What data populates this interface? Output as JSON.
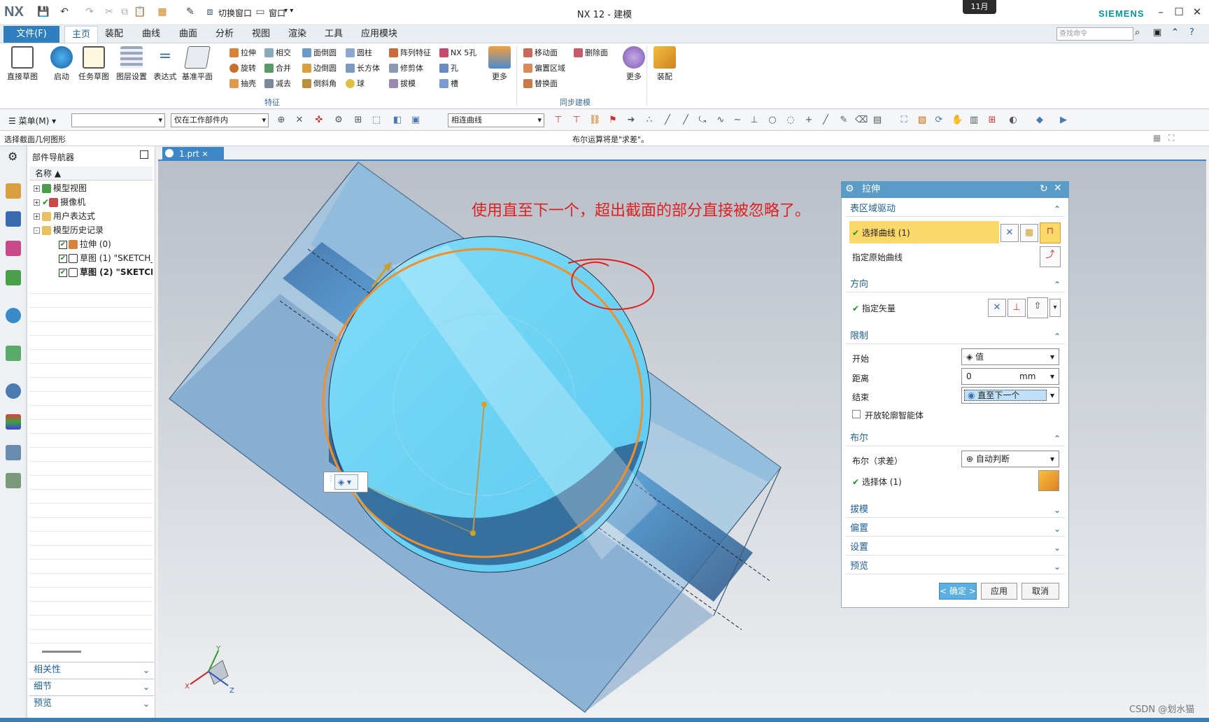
{
  "title_bar": {
    "logo": "NX",
    "switch_window": "切换窗口",
    "window_menu": "窗口",
    "title": "NX 12 - 建模",
    "date_badge": "11月",
    "brand": "SIEMENS",
    "brand_color": "#009999"
  },
  "menu": {
    "file": "文件(F)",
    "tabs": [
      "主页",
      "装配",
      "曲线",
      "曲面",
      "分析",
      "视图",
      "渲染",
      "工具",
      "应用模块"
    ],
    "active_tab": "主页",
    "search_placeholder": "查找命令"
  },
  "ribbon": {
    "big_buttons": [
      "直接草图",
      "启动",
      "任务草图",
      "图层设置",
      "表达式",
      "基准平面"
    ],
    "feature_col1": [
      "拉伸",
      "旋转",
      "抽壳"
    ],
    "feature_col2": [
      "相交",
      "合并",
      "减去"
    ],
    "feature_col3": [
      "面倒圆",
      "边倒圆",
      "倒斜角"
    ],
    "feature_col4": [
      "圆柱",
      "长方体",
      "球"
    ],
    "feature_col5": [
      "阵列特征",
      "修剪体",
      "拔模"
    ],
    "feature_col6": [
      "NX 5孔",
      "孔",
      "槽"
    ],
    "more1": "更多",
    "group_feature": "特征",
    "sync_col1": [
      "移动面",
      "偏置区域",
      "替换面"
    ],
    "sync_col2": [
      "删除面"
    ],
    "more2": "更多",
    "group_sync": "同步建模",
    "assembly": "装配"
  },
  "toolbar2": {
    "menu": "菜单(M)",
    "filter_value": "",
    "scope": "仅在工作部件内",
    "curve_rule": "相连曲线"
  },
  "status": {
    "left": "选择截面几何图形",
    "center": "布尔运算将是\"求差\"。"
  },
  "navigator": {
    "title": "部件导航器",
    "column": "名称",
    "items": [
      {
        "label": "模型视图",
        "level": 0,
        "toggle": "+"
      },
      {
        "label": "摄像机",
        "level": 0,
        "toggle": "+"
      },
      {
        "label": "用户表达式",
        "level": 0,
        "toggle": "+"
      },
      {
        "label": "模型历史记录",
        "level": 0,
        "toggle": "-"
      },
      {
        "label": "拉伸 (0)",
        "level": 1
      },
      {
        "label": "草图 (1) \"SKETCH_",
        "level": 1
      },
      {
        "label": "草图 (2) \"SKETCH",
        "level": 1
      }
    ],
    "sections": [
      "相关性",
      "细节",
      "预览"
    ]
  },
  "document_tab": "1.prt",
  "annotation": "使用直至下一个，超出截面的部分直接被忽略了。",
  "axes": {
    "x": "X",
    "y": "Y",
    "z": "Z"
  },
  "dialog": {
    "title": "拉伸",
    "sec_section": "表区域驱动",
    "select_curve": "选择曲线 (1)",
    "specify_origin_curve": "指定原始曲线",
    "sec_direction": "方向",
    "specify_vector": "指定矢量",
    "sec_limits": "限制",
    "start_label": "开始",
    "start_value": "值",
    "distance_label": "距离",
    "distance_value": "0",
    "distance_unit": "mm",
    "end_label": "结束",
    "end_value": "直至下一个",
    "open_profile": "开放轮廓智能体",
    "sec_boolean": "布尔",
    "boolean_label": "布尔（求差）",
    "boolean_value": "自动判断",
    "select_body": "选择体 (1)",
    "collapsed": [
      "拔模",
      "偏置",
      "设置",
      "预览"
    ],
    "ok": "< 确定 >",
    "apply": "应用",
    "cancel": "取消"
  },
  "watermark": "CSDN @划水猫"
}
